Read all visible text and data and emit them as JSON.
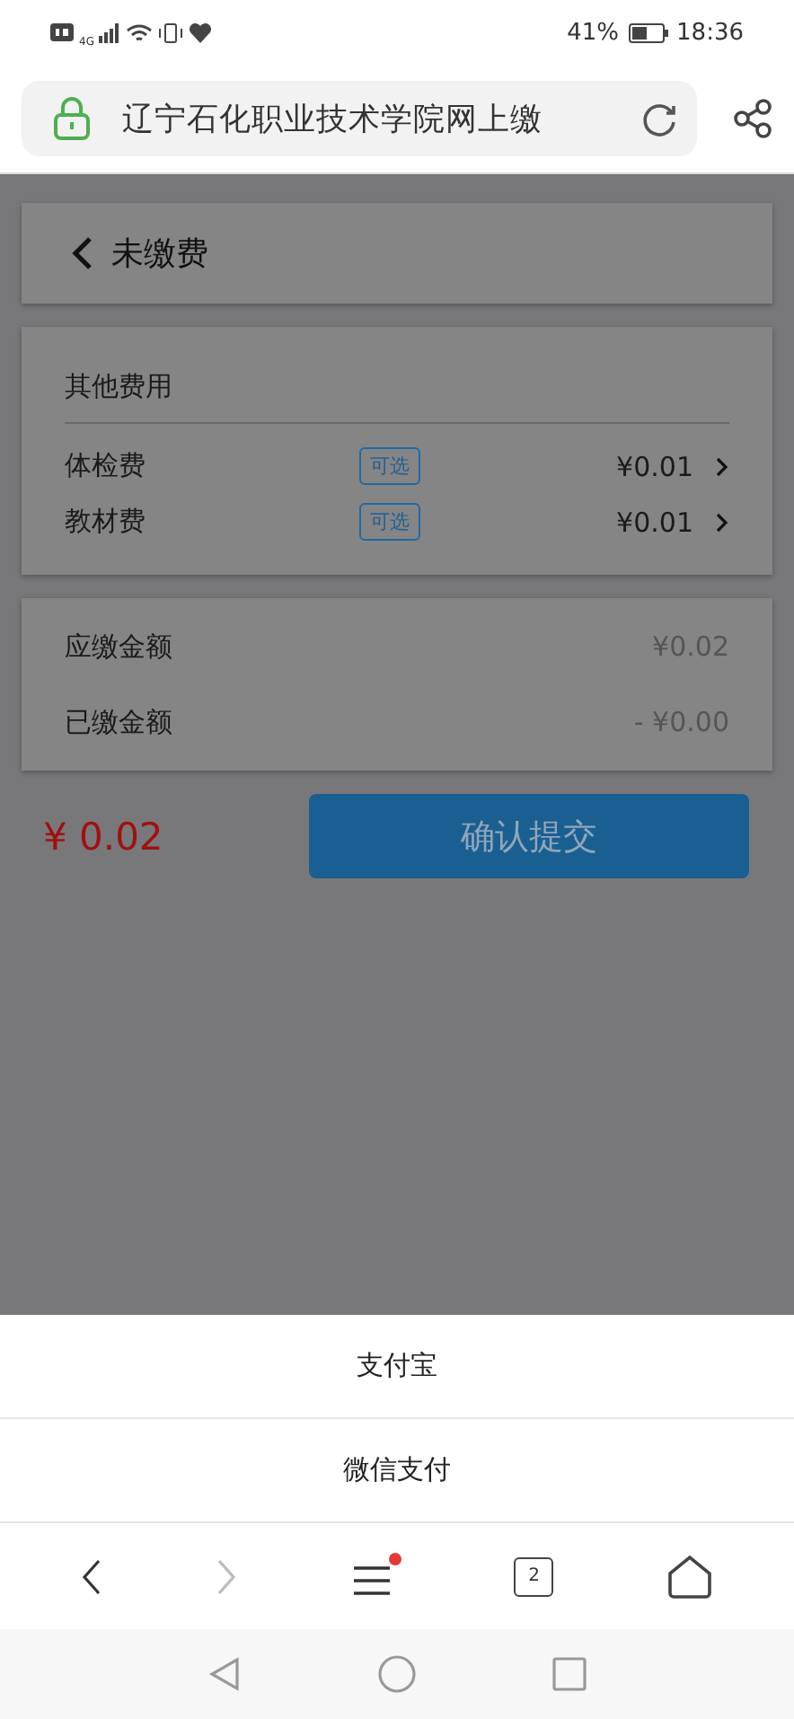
{
  "status_bar": {
    "battery": "41%",
    "time": "18:36",
    "network": "4G"
  },
  "browser": {
    "address": "辽宁石化职业技术学院网上缴"
  },
  "page": {
    "title": "未缴费",
    "section": "其他费用",
    "items": [
      {
        "name": "体检费",
        "tag": "可选",
        "amount": "¥0.01"
      },
      {
        "name": "教材费",
        "tag": "可选",
        "amount": "¥0.01"
      }
    ],
    "summary": [
      {
        "label": "应缴金额",
        "value": "¥0.02"
      },
      {
        "label": "已缴金额",
        "value": "- ¥0.00"
      }
    ],
    "total": "¥ 0.02",
    "submit": "确认提交"
  },
  "action_sheet": {
    "options": [
      "支付宝",
      "微信支付"
    ]
  },
  "toolbar": {
    "tab_count": "2",
    "menu_badge": true,
    "forward_disabled": true
  }
}
